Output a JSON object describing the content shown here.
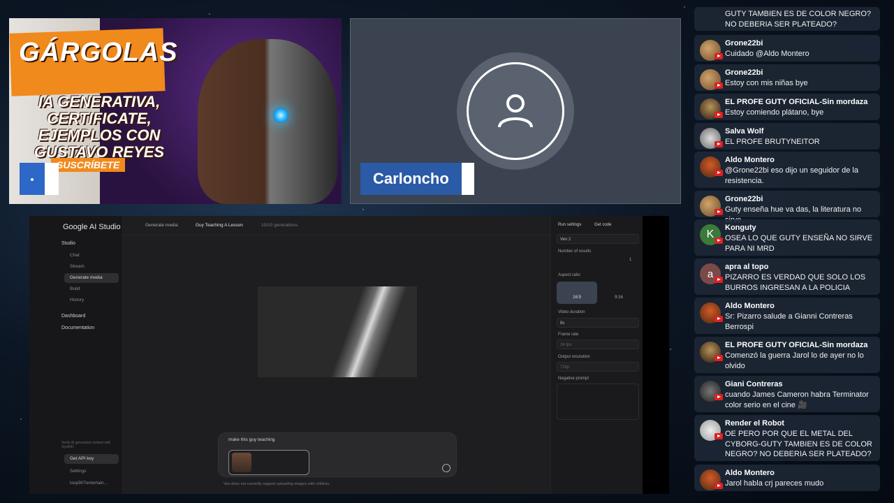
{
  "thumbnail": {
    "title": "GÁRGOLAS",
    "subtitle": "IA GENERATIVA, CERTIFICATE, EJEMPLOS CON GUSTAVO REYES",
    "subscribe": "SUSCRÍBETE"
  },
  "camera": {
    "name": "Carloncho"
  },
  "ai_studio": {
    "logo": "Google AI Studio",
    "sidebar": {
      "studio": "Studio",
      "items": [
        "Chat",
        "Stream",
        "Generate media",
        "Build",
        "History"
      ],
      "dashboard": "Dashboard",
      "documentation": "Documentation",
      "footer_note": "Verify AI generated content with SynthID",
      "get_api_key": "Get API key",
      "settings": "Settings",
      "account": "loop907entertain..."
    },
    "topbar": {
      "section": "Generate media",
      "project": "Guy Teaching A Lesson",
      "gen_count": "10/10 generations"
    },
    "prompt": {
      "text": "make this guy teaching",
      "note": "Veo does not currently support uploading images with children."
    },
    "run_settings": {
      "title": "Run settings",
      "get_code": "Get code",
      "model": "Veo 2",
      "num_results_label": "Number of results",
      "num_results": "1",
      "aspect_label": "Aspect ratio",
      "aspect_169": "16:9",
      "aspect_916": "9:16",
      "duration_label": "Video duration",
      "duration": "8s",
      "frame_rate_label": "Frame rate",
      "frame_rate": "24 fps",
      "resolution_label": "Output resolution",
      "resolution": "720p",
      "negative_label": "Negative prompt"
    }
  },
  "chat": [
    {
      "author": "",
      "text": "GUTY TAMBIEN ES DE COLOR NEGRO? NO DEBERIA SER PLATEADO?",
      "avatar": "none"
    },
    {
      "author": "Grone22bi",
      "text": "Cuidado @Aldo Montero",
      "avatar": "g22"
    },
    {
      "author": "Grone22bi",
      "text": "Estoy con mis niñas bye",
      "avatar": "g22"
    },
    {
      "author": "EL PROFE GUTY OFICIAL-Sin mordaza",
      "text": "Estoy comiendo plátano, bye",
      "avatar": "guty"
    },
    {
      "author": "Salva Wolf",
      "text": "EL PROFE BRUTYNEITOR",
      "avatar": "salva"
    },
    {
      "author": "Aldo Montero",
      "text": "@Grone22bi eso dijo un seguidor de la resistencia.",
      "avatar": "aldo"
    },
    {
      "author": "Grone22bi",
      "text": "Guty enseña hue va das, la literatura no sirve",
      "avatar": "g22"
    },
    {
      "author": "Konguty",
      "text": "OSEA LO QUE GUTY ENSEÑA NO SIRVE PARA NI MRD",
      "avatar": "k",
      "initial": "K"
    },
    {
      "author": "apra al topo",
      "text": "PIZARRO ES VERDAD QUE SOLO LOS BURROS INGRESAN A LA POLICIA",
      "avatar": "a",
      "initial": "a"
    },
    {
      "author": "Aldo Montero",
      "text": "Sr: Pizarro salude a Gianni Contreras Berrospi",
      "avatar": "aldo"
    },
    {
      "author": "EL PROFE GUTY OFICIAL-Sin mordaza",
      "text": "Comenzó la guerra Jarol lo de ayer no lo olvido",
      "avatar": "guty"
    },
    {
      "author": "Giani Contreras",
      "text": "cuando James Cameron habra Terminator color serio en el cine 🎥",
      "avatar": "giani"
    },
    {
      "author": "Render el Robot",
      "text": "OE PERO POR QUE EL METAL DEL CYBORG-GUTY TAMBIEN ES DE COLOR NEGRO? NO DEBERIA SER PLATEADO?",
      "avatar": "render"
    },
    {
      "author": "Aldo Montero",
      "text": "Jarol habla crj pareces mudo",
      "avatar": "aldo"
    }
  ]
}
